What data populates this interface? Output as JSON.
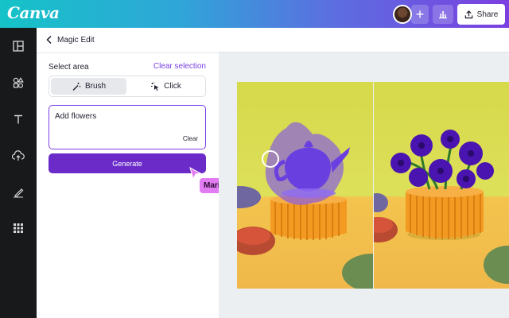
{
  "app": {
    "logo": "Canva"
  },
  "topbar": {
    "share_label": "Share",
    "icons": [
      "avatar",
      "plus-icon",
      "bar-chart-icon",
      "share-icon"
    ]
  },
  "rail": {
    "items": [
      "layout-icon",
      "elements-icon",
      "text-icon",
      "upload-icon",
      "draw-icon",
      "apps-icon"
    ]
  },
  "panel": {
    "title": "Magic Edit",
    "select_area_label": "Select area",
    "clear_selection_label": "Clear selection",
    "modes": [
      {
        "label": "Brush",
        "icon": "magic-brush-icon",
        "selected": true
      },
      {
        "label": "Click",
        "icon": "magic-click-icon",
        "selected": false
      }
    ],
    "prompt": {
      "value": "Add flowers",
      "clear_label": "Clear"
    },
    "generate_label": "Generate"
  },
  "collaborator": {
    "name": "Mario",
    "color": "#e27cf2"
  },
  "colors": {
    "accent": "#7b3fe4",
    "generate": "#6a2bc9",
    "selection": "#7a4ef0",
    "rail": "#18191b"
  }
}
